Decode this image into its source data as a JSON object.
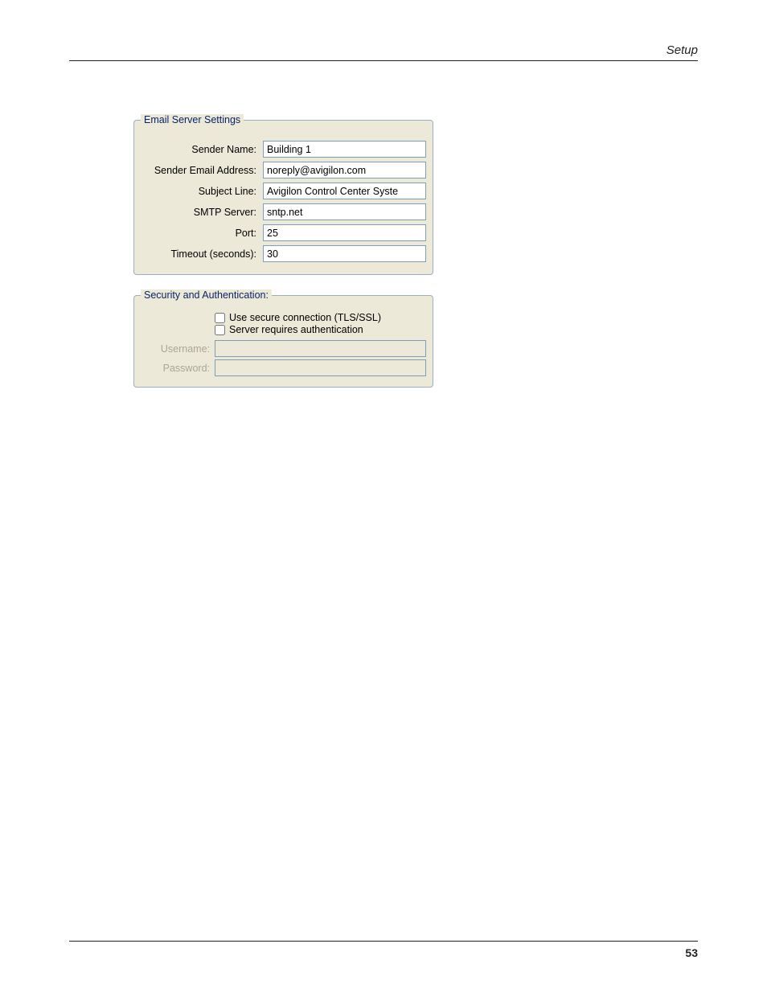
{
  "header": {
    "section": "Setup"
  },
  "footer": {
    "page_number": "53"
  },
  "email_server": {
    "legend": "Email Server Settings",
    "labels": {
      "sender_name": "Sender Name:",
      "sender_email": "Sender Email Address:",
      "subject_line": "Subject Line:",
      "smtp_server": "SMTP Server:",
      "port": "Port:",
      "timeout": "Timeout (seconds):"
    },
    "values": {
      "sender_name": "Building 1",
      "sender_email": "noreply@avigilon.com",
      "subject_line": "Avigilon Control Center Syste",
      "smtp_server": "sntp.net",
      "port": "25",
      "timeout": "30"
    }
  },
  "auth": {
    "legend": "Security and Authentication:",
    "checks": {
      "tls": "Use secure connection (TLS/SSL)",
      "auth": "Server requires authentication"
    },
    "labels": {
      "username": "Username:",
      "password": "Password:"
    },
    "values": {
      "username": "",
      "password": ""
    }
  }
}
